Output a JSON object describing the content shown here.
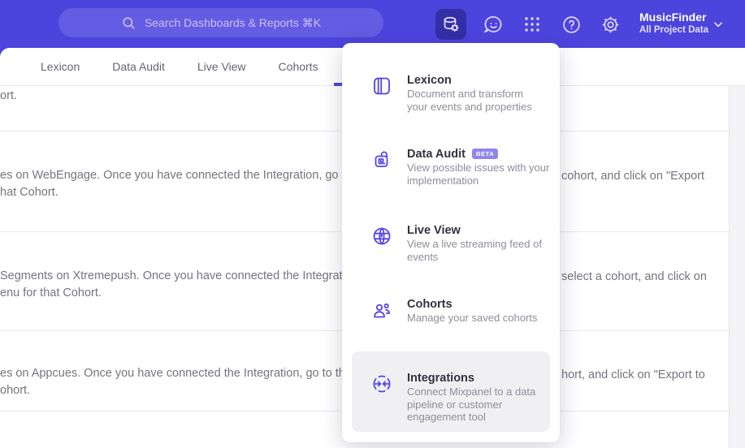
{
  "colors": {
    "accent": "#4f44e0",
    "header_bg": "#4d44de",
    "icon_indigo": "#5646e4",
    "badge_bg": "#9087eb",
    "highlight_bg": "#f0f0f3"
  },
  "header": {
    "search_label": "Search Dashboards & Reports ⌘K",
    "project_name": "MusicFinder",
    "project_subtitle": "All Project Data",
    "help_glyph": "?",
    "icon_names": [
      "database-gear-icon",
      "feedback-smiley-icon",
      "apps-grid-icon",
      "help-icon",
      "settings-gear-icon",
      "chevron-down-icon"
    ]
  },
  "tabs": {
    "items": [
      {
        "label": "Lexicon"
      },
      {
        "label": "Data Audit"
      },
      {
        "label": "Live View"
      },
      {
        "label": "Cohorts"
      }
    ]
  },
  "menu": {
    "items": [
      {
        "title": "Lexicon",
        "icon": "lexicon-icon",
        "desc_lines": [
          "Document and transform",
          "your events and properties"
        ]
      },
      {
        "title": "Data Audit",
        "badge": "BETA",
        "icon": "data-audit-icon",
        "desc_lines": [
          "View possible issues with your",
          "implementation"
        ]
      },
      {
        "title": "Live View",
        "icon": "live-view-icon",
        "desc_lines": [
          "View a live streaming feed of",
          "events"
        ]
      },
      {
        "title": "Cohorts",
        "icon": "cohorts-icon",
        "desc_lines": [
          "Manage your saved cohorts"
        ]
      },
      {
        "title": "Integrations",
        "icon": "integrations-icon",
        "highlighted": true,
        "desc_lines": [
          "Connect Mixpanel to a data",
          "pipeline or customer",
          "engagement tool"
        ]
      }
    ]
  },
  "content": {
    "rows": [
      {
        "line1_left": "ort.",
        "line1_right": "",
        "line2": ""
      },
      {
        "line1_left": "es on WebEngage. Once you have connected the Integration, go to the",
        "line1_right": "cohort, and click on \"Export",
        "line2": "hat Cohort."
      },
      {
        "line1_left": "Segments on Xtremepush. Once you have connected the Integration,",
        "line1_right": "select a cohort, and click on",
        "line2": "enu for that Cohort."
      },
      {
        "line1_left": "es on Appcues. Once you have connected the Integration, go to the M",
        "line1_right": "hort, and click on \"Export to",
        "line2": "ohort."
      }
    ]
  }
}
